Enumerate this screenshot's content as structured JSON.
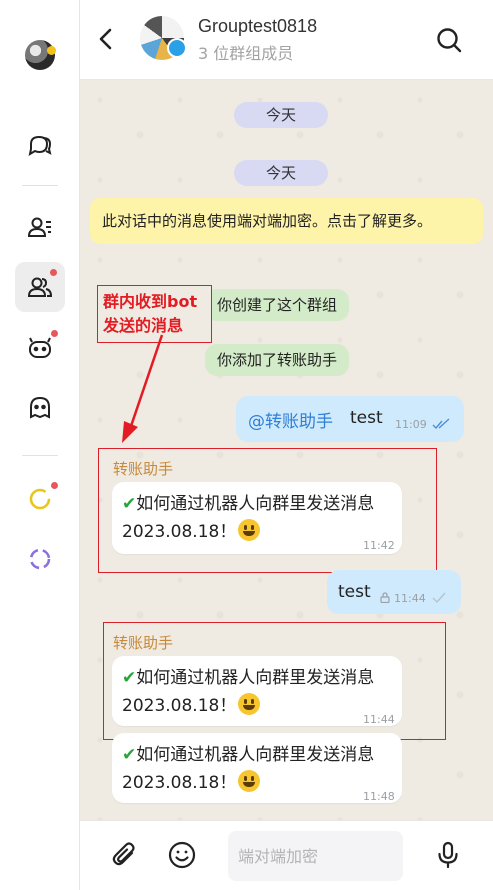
{
  "header": {
    "title": "Grouptest0818",
    "subtitle": "3 位群组成员"
  },
  "chat": {
    "date_1": "今天",
    "date_2": "今天",
    "encryption_notice": "此对话中的消息使用端对端加密。点击了解更多。",
    "system_1": "你创建了这个群组",
    "system_2": "你添加了转账助手",
    "annotation": "群内收到bot发送的消息",
    "messages": [
      {
        "direction": "out",
        "mention": "@转账助手",
        "text": "test",
        "time": "11:09",
        "status": "read"
      },
      {
        "direction": "in",
        "sender": "转账助手",
        "text": "如何通过机器人向群里发送消息2023.08.18！",
        "time": "11:42"
      },
      {
        "direction": "out",
        "text": "test",
        "time": "11:44",
        "status": "pending"
      },
      {
        "direction": "in",
        "sender": "转账助手",
        "text": "如何通过机器人向群里发送消息2023.08.18！",
        "time": "11:44"
      },
      {
        "direction": "in",
        "text": "如何通过机器人向群里发送消息2023.08.18！",
        "time": "11:48"
      }
    ]
  },
  "input": {
    "placeholder": "端对端加密"
  },
  "colors": {
    "chat_background": "#efeae2",
    "outgoing_bubble": "#cfeafc",
    "date_pill": "#d8d9f3",
    "notice": "#fdf3a9",
    "system_pill": "#d3ebc8",
    "sender_name": "#c8893a",
    "mention": "#2f7fd6",
    "annotation_red": "#e31b23",
    "badge_dot": "#e8585a"
  },
  "icons": [
    "chat-bubbles-icon",
    "contacts-icon",
    "groups-icon",
    "bot-icon",
    "ghost-icon",
    "yellow-status-ring-icon",
    "purple-status-ring-icon",
    "back-arrow-icon",
    "search-icon",
    "paperclip-icon",
    "emoji-icon",
    "microphone-icon"
  ]
}
